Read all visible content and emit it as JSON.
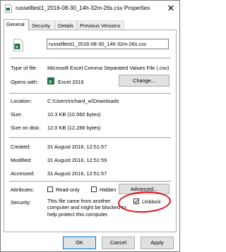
{
  "window": {
    "title": "russelltest1_2016-08-30_14h-32m-26s.csv Properties",
    "close_glyph": "✕"
  },
  "tabs": [
    {
      "label": "General"
    },
    {
      "label": "Security"
    },
    {
      "label": "Details"
    },
    {
      "label": "Previous Versions"
    }
  ],
  "file": {
    "name": "russelltest1_2016-08-30_14h-32m-26s.csv"
  },
  "type_section": {
    "type_label": "Type of file:",
    "type_value": "Microsoft Excel Comma Separated Values File (.csv)",
    "opens_label": "Opens with:",
    "opens_value": "Excel 2016",
    "change_button": "Change..."
  },
  "location_section": {
    "location_label": "Location:",
    "location_value": "C:\\Users\\richard_w\\Downloads",
    "size_label": "Size:",
    "size_value": "10.3 KB (10,560 bytes)",
    "size_on_disk_label": "Size on disk:",
    "size_on_disk_value": "12.0 KB (12,288 bytes)"
  },
  "dates_section": {
    "created_label": "Created:",
    "created_value": "31 August 2016, 12:51:57",
    "modified_label": "Modified:",
    "modified_value": "31 August 2016, 12:51:59",
    "accessed_label": "Accessed:",
    "accessed_value": "31 August 2016, 12:51:57"
  },
  "attributes": {
    "label": "Attributes:",
    "readonly_label": "Read-only",
    "readonly_checked": false,
    "hidden_label": "Hidden",
    "hidden_checked": false,
    "advanced_button": "Advanced..."
  },
  "security": {
    "label": "Security:",
    "text": "This file came from another computer and might be blocked to help protect this computer.",
    "unblock_label": "Unblock",
    "unblock_checked": true,
    "highlight_color": "#e0101a"
  },
  "buttons": {
    "ok": "OK",
    "cancel": "Cancel",
    "apply": "Apply"
  },
  "colors": {
    "excel_green": "#1e7145",
    "focus_blue": "#0078d7"
  }
}
